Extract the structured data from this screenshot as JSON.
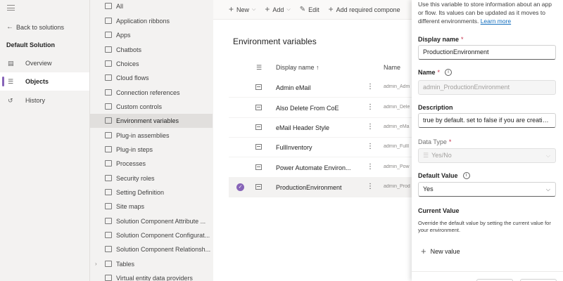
{
  "nav": {
    "back_label": "Back to solutions",
    "solution_title": "Default Solution",
    "items": [
      {
        "label": "Overview",
        "icon": "overview-icon"
      },
      {
        "label": "Objects",
        "icon": "objects-icon"
      },
      {
        "label": "History",
        "icon": "history-icon"
      }
    ]
  },
  "tree": {
    "items": [
      "All",
      "Application ribbons",
      "Apps",
      "Chatbots",
      "Choices",
      "Cloud flows",
      "Connection references",
      "Custom controls",
      "Environment variables",
      "Plug-in assemblies",
      "Plug-in steps",
      "Processes",
      "Security roles",
      "Setting Definition",
      "Site maps",
      "Solution Component Attribute ...",
      "Solution Component Configurat...",
      "Solution Component Relationsh...",
      "Tables",
      "Virtual entity data providers"
    ]
  },
  "commands": {
    "new": "New",
    "add": "Add",
    "edit": "Edit",
    "add_required": "Add required compone"
  },
  "main": {
    "title": "Environment variables",
    "col_display": "Display name ↑",
    "col_name": "Name",
    "rows": [
      {
        "display": "Admin eMail",
        "name": "admin_Adm"
      },
      {
        "display": "Also Delete From CoE",
        "name": "admin_Dele"
      },
      {
        "display": "eMail Header Style",
        "name": "admin_eMa"
      },
      {
        "display": "FullInventory",
        "name": "admin_FullI"
      },
      {
        "display": "Power Automate Environ...",
        "name": "admin_Pow"
      },
      {
        "display": "ProductionEnvironment",
        "name": "admin_Prod"
      }
    ]
  },
  "panel": {
    "description": "Use this variable to store information about an app or flow. Its values can be updated as it moves to different environments.",
    "learn_more": "Learn more",
    "display_name_label": "Display name",
    "display_name_value": "ProductionEnvironment",
    "name_label": "Name",
    "name_value": "admin_ProductionEnvironment",
    "description_label": "Description",
    "description_value": "true by default. set to false if you are creating...",
    "data_type_label": "Data Type",
    "data_type_value": "Yes/No",
    "default_value_label": "Default Value",
    "default_value": "Yes",
    "current_value_label": "Current Value",
    "current_value_help": "Override the default value by setting the current value for your environment.",
    "new_value_label": "New value",
    "required_mark": "*"
  },
  "colors": {
    "accent": "#8764b8",
    "link": "#0f6cbd",
    "required": "#c4314b"
  }
}
